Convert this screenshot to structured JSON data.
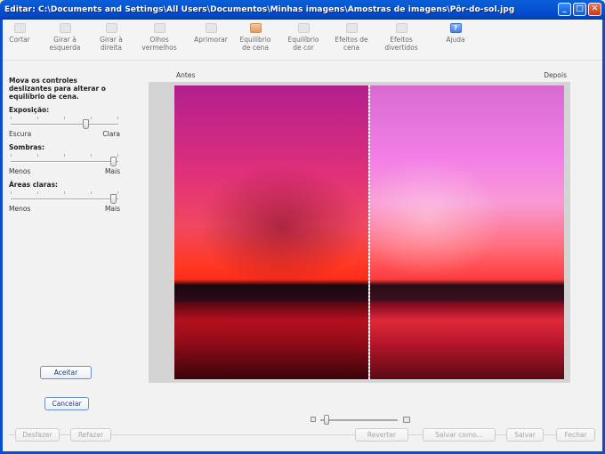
{
  "window": {
    "title": "Editar:  C:\\Documents and Settings\\All Users\\Documentos\\Minhas imagens\\Amostras de imagens\\Pôr-do-sol.jpg"
  },
  "window_controls": {
    "minimize": "_",
    "maximize": "□",
    "close": "✕"
  },
  "toolbar": [
    {
      "label": "Cortar",
      "icon": "crop-icon"
    },
    {
      "label": "Girar à esquerda",
      "icon": "rotate-left-icon"
    },
    {
      "label": "Girar à direita",
      "icon": "rotate-right-icon"
    },
    {
      "label": "Olhos vermelhos",
      "icon": "red-eye-icon"
    },
    {
      "label": "Aprimorar",
      "icon": "sharpen-icon"
    },
    {
      "label": "Equilíbrio de cena",
      "icon": "scene-balance-icon",
      "active": true
    },
    {
      "label": "Equilíbrio de cor",
      "icon": "color-balance-icon"
    },
    {
      "label": "Efeitos de cena",
      "icon": "scene-effects-icon"
    },
    {
      "label": "Efeitos divertidos",
      "icon": "fun-effects-icon"
    },
    {
      "label": "Ajuda",
      "icon": "help-icon"
    }
  ],
  "panel": {
    "instructions": "Mova os controles deslizantes para alterar o equilíbrio de cena.",
    "exposure": {
      "label": "Exposição:",
      "min_label": "Escura",
      "max_label": "Clara",
      "value": 0.7
    },
    "shadows": {
      "label": "Sombras:",
      "min_label": "Menos",
      "max_label": "Mais",
      "value": 0.97
    },
    "highlights": {
      "label": "Áreas claras:",
      "min_label": "Menos",
      "max_label": "Mais",
      "value": 0.97
    }
  },
  "actions": {
    "accept": "Aceitar",
    "cancel": "Cancelar"
  },
  "preview": {
    "before_label": "Antes",
    "after_label": "Depois",
    "help_glyph": "?"
  },
  "zoom": {
    "value": 0.05
  },
  "bottom_buttons": {
    "undo": "Desfazer",
    "redo": "Refazer",
    "revert": "Reverter",
    "save_as": "Salvar como...",
    "save": "Salvar",
    "close": "Fechar"
  },
  "colors": {
    "titlebar": "#0554d3",
    "accent_border": "#6d8fc8",
    "active_tool": "#e89a63"
  }
}
